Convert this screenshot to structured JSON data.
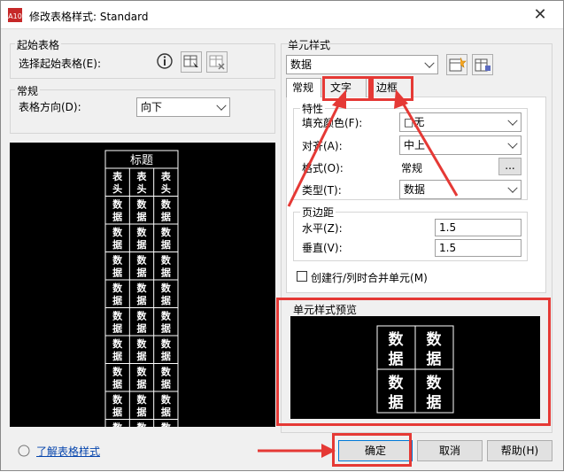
{
  "window": {
    "title": "修改表格样式: Standard",
    "app_icon_text": "A10"
  },
  "left": {
    "start_table_group": "起始表格",
    "select_start_table_label": "选择起始表格(E):",
    "general_group": "常规",
    "direction_label": "表格方向(D):",
    "direction_value": "向下",
    "preview_title": "标题",
    "preview_header_cell": "表头",
    "preview_data_cell": "数据",
    "learn_link": "了解表格样式"
  },
  "cell_style": {
    "group_label": "单元样式",
    "selected": "数据",
    "tabs": [
      {
        "label": "常规"
      },
      {
        "label": "文字"
      },
      {
        "label": "边框"
      }
    ],
    "properties_group": "特性",
    "fill_color_label": "填充颜色(F):",
    "fill_color_value": "□无",
    "alignment_label": "对齐(A):",
    "alignment_value": "中上",
    "format_label": "格式(O):",
    "format_value": "常规",
    "format_button": "...",
    "type_label": "类型(T):",
    "type_value": "数据",
    "margins_group": "页边距",
    "horizontal_label": "水平(Z):",
    "horizontal_value": "1.5",
    "vertical_label": "垂直(V):",
    "vertical_value": "1.5",
    "merge_checkbox_label": "创建行/列时合并单元(M)",
    "preview_group": "单元样式预览",
    "preview_cell": "数据"
  },
  "buttons": {
    "ok": "确定",
    "cancel": "取消",
    "help": "帮助(H)"
  },
  "colors": {
    "highlight_red": "#e53935",
    "preview_bg": "#000000"
  },
  "preview_rows": 9
}
